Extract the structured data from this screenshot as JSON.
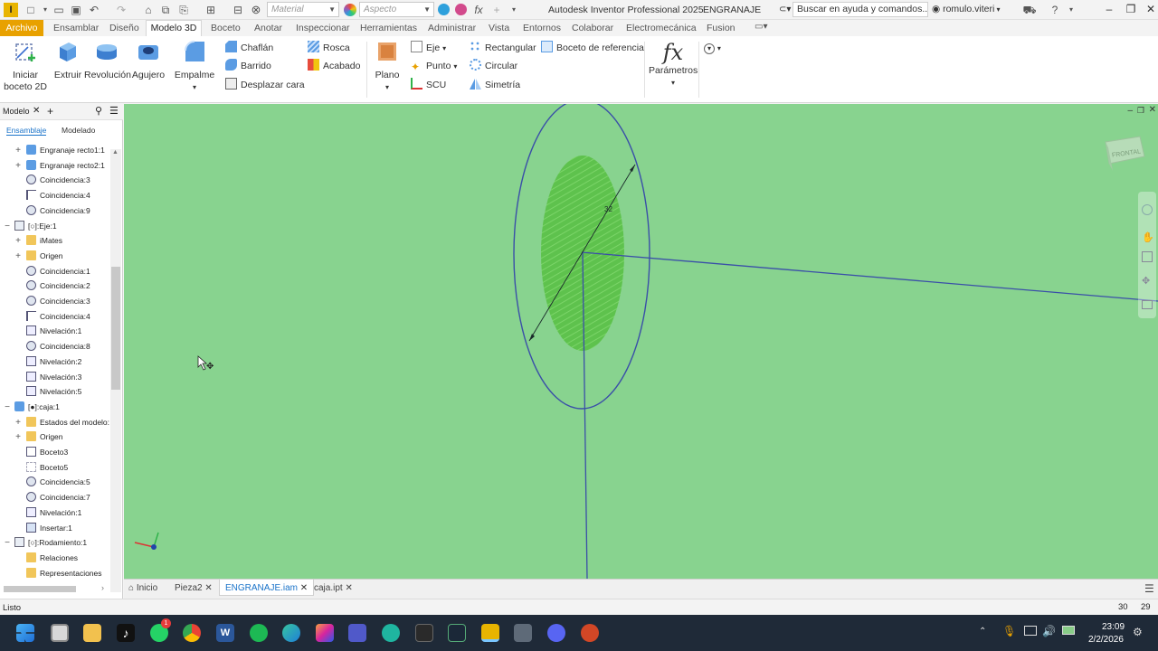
{
  "titlebar": {
    "app_title": "Autodesk Inventor Professional 2025",
    "doc_title": "ENGRANAJE",
    "material_placeholder": "Material",
    "appearance_placeholder": "Aspecto",
    "help_search": "Buscar en ayuda y comandos...",
    "user": "romulo.viteri"
  },
  "menu": {
    "archivo": "Archivo",
    "tabs": [
      "Ensamblar",
      "Diseño",
      "Modelo 3D",
      "Boceto",
      "Anotar",
      "Inspeccionar",
      "Herramientas",
      "Administrar",
      "Vista",
      "Entornos",
      "Colaborar",
      "Electromecánica",
      "Fusion"
    ],
    "active": "Modelo 3D"
  },
  "ribbon": {
    "start_sketch": "Iniciar\nboceto 2D",
    "start_sketch_l1": "Iniciar",
    "start_sketch_l2": "boceto 2D",
    "extrude": "Extruir",
    "revolve": "Revolución",
    "hole": "Agujero",
    "fillet": "Empalme",
    "chamfer": "Chaflán",
    "sweep": "Barrido",
    "move_face": "Desplazar cara",
    "thread": "Rosca",
    "appearance": "Acabado",
    "plane": "Plano",
    "axis": "Eje",
    "point": "Punto",
    "ucs": "SCU",
    "rectangular": "Rectangular",
    "circular": "Circular",
    "mirror": "Simetría",
    "ref_sketch": "Boceto de referencia",
    "parameters": "Parámetros",
    "fx": "fx"
  },
  "browser": {
    "title": "Modelo",
    "tab_assembly": "Ensamblaje",
    "tab_modeling": "Modelado",
    "items": [
      {
        "label": "Engranaje recto1:1",
        "icon": "part-icon",
        "indent": 1,
        "expand": "+"
      },
      {
        "label": "Engranaje recto2:1",
        "icon": "part-icon",
        "indent": 1,
        "expand": "+"
      },
      {
        "label": "Coincidencia:3",
        "icon": "constraint-icon",
        "indent": 1,
        "expand": ""
      },
      {
        "label": "Coincidencia:4",
        "icon": "constraint-flag-icon",
        "indent": 1,
        "expand": ""
      },
      {
        "label": "Coincidencia:9",
        "icon": "constraint-icon",
        "indent": 1,
        "expand": ""
      },
      {
        "label": "[○]:Eje:1",
        "icon": "assembly-icon",
        "indent": 0,
        "expand": "−"
      },
      {
        "label": "iMates",
        "icon": "folder-icon",
        "indent": 1,
        "expand": "+"
      },
      {
        "label": "Origen",
        "icon": "folder-icon",
        "indent": 1,
        "expand": "+"
      },
      {
        "label": "Coincidencia:1",
        "icon": "constraint-icon",
        "indent": 1,
        "expand": ""
      },
      {
        "label": "Coincidencia:2",
        "icon": "constraint-icon",
        "indent": 1,
        "expand": ""
      },
      {
        "label": "Coincidencia:3",
        "icon": "constraint-icon",
        "indent": 1,
        "expand": ""
      },
      {
        "label": "Coincidencia:4",
        "icon": "constraint-flag-icon",
        "indent": 1,
        "expand": ""
      },
      {
        "label": "Nivelación:1",
        "icon": "flush-icon",
        "indent": 1,
        "expand": ""
      },
      {
        "label": "Coincidencia:8",
        "icon": "constraint-icon",
        "indent": 1,
        "expand": ""
      },
      {
        "label": "Nivelación:2",
        "icon": "flush-icon",
        "indent": 1,
        "expand": ""
      },
      {
        "label": "Nivelación:3",
        "icon": "flush-icon",
        "indent": 1,
        "expand": ""
      },
      {
        "label": "Nivelación:5",
        "icon": "flush-icon",
        "indent": 1,
        "expand": ""
      },
      {
        "label": "[●]:caja:1",
        "icon": "part-icon",
        "indent": 0,
        "expand": "−"
      },
      {
        "label": "Estados del modelo:",
        "icon": "folder-icon",
        "indent": 1,
        "expand": "+"
      },
      {
        "label": "Origen",
        "icon": "folder-icon",
        "indent": 1,
        "expand": "+"
      },
      {
        "label": "Boceto3",
        "icon": "sketch-icon",
        "indent": 1,
        "expand": ""
      },
      {
        "label": "Boceto5",
        "icon": "sketch-faded-icon",
        "indent": 1,
        "expand": ""
      },
      {
        "label": "Coincidencia:5",
        "icon": "constraint-icon",
        "indent": 1,
        "expand": ""
      },
      {
        "label": "Coincidencia:7",
        "icon": "constraint-icon",
        "indent": 1,
        "expand": ""
      },
      {
        "label": "Nivelación:1",
        "icon": "flush-icon",
        "indent": 1,
        "expand": ""
      },
      {
        "label": "Insertar:1",
        "icon": "insert-icon",
        "indent": 1,
        "expand": ""
      },
      {
        "label": "[○]:Rodamiento:1",
        "icon": "assembly-icon",
        "indent": 0,
        "expand": "−"
      },
      {
        "label": "Relaciones",
        "icon": "folder-icon",
        "indent": 1,
        "expand": ""
      },
      {
        "label": "Representaciones",
        "icon": "folder-icon",
        "indent": 1,
        "expand": ""
      }
    ]
  },
  "viewport": {
    "dimension_label": "32",
    "viewcube_label": "FRONTAL"
  },
  "doc_tabs": {
    "home": "Inicio",
    "tabs": [
      "Pieza2",
      "ENGRANAJE.iam",
      "caja.ipt"
    ],
    "active": "ENGRANAJE.iam"
  },
  "status": {
    "text": "Listo",
    "count1": "30",
    "count2": "29"
  },
  "taskbar": {
    "time": "23:09",
    "date": "2/2/2026",
    "whatsapp_badge": "1",
    "icons": [
      "windows-start-icon",
      "task-view-icon",
      "file-explorer-icon",
      "tiktok-icon",
      "whatsapp-icon",
      "chrome-icon",
      "word-icon",
      "spotify-icon",
      "edge-icon",
      "instagram-icon",
      "teams-icon",
      "curseforge-icon",
      "epic-games-icon",
      "steam-icon",
      "inventor-icon",
      "calculator-icon",
      "discord-icon",
      "powerpoint-icon"
    ]
  },
  "colors": {
    "viewport_bg": "#88d38f",
    "accent_orange": "#e8a100",
    "sketch_blue": "#3a4fa8",
    "face_green": "#5cc14a"
  }
}
